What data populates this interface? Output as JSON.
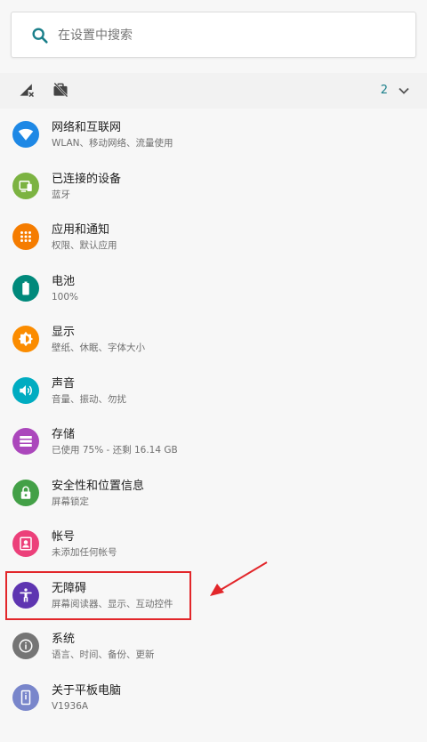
{
  "search": {
    "placeholder": "在设置中搜索"
  },
  "conditions": {
    "count": "2"
  },
  "settings": [
    {
      "title": "网络和互联网",
      "subtitle": "WLAN、移动网络、流量使用",
      "icon": "wifi-icon",
      "color": "#1e88e5"
    },
    {
      "title": "已连接的设备",
      "subtitle": "蓝牙",
      "icon": "devices-icon",
      "color": "#7cb342"
    },
    {
      "title": "应用和通知",
      "subtitle": "权限、默认应用",
      "icon": "apps-icon",
      "color": "#f57c00"
    },
    {
      "title": "电池",
      "subtitle": "100%",
      "icon": "battery-icon",
      "color": "#00897b"
    },
    {
      "title": "显示",
      "subtitle": "壁纸、休眠、字体大小",
      "icon": "brightness-icon",
      "color": "#fb8c00"
    },
    {
      "title": "声音",
      "subtitle": "音量、振动、勿扰",
      "icon": "volume-icon",
      "color": "#00acc1"
    },
    {
      "title": "存储",
      "subtitle": "已使用 75% - 还剩 16.14 GB",
      "icon": "storage-icon",
      "color": "#ab47bc"
    },
    {
      "title": "安全性和位置信息",
      "subtitle": "屏幕锁定",
      "icon": "lock-icon",
      "color": "#43a047"
    },
    {
      "title": "帐号",
      "subtitle": "未添加任何帐号",
      "icon": "account-icon",
      "color": "#ec407a"
    },
    {
      "title": "无障碍",
      "subtitle": "屏幕阅读器、显示、互动控件",
      "icon": "accessibility-icon",
      "color": "#5e35b1"
    },
    {
      "title": "系统",
      "subtitle": "语言、时间、备份、更新",
      "icon": "info-icon",
      "color": "#757575"
    },
    {
      "title": "关于平板电脑",
      "subtitle": "V1936A",
      "icon": "tablet-icon",
      "color": "#7986cb"
    }
  ],
  "colors": {
    "accent": "#1a7f8a",
    "highlight": "#e2262a"
  }
}
